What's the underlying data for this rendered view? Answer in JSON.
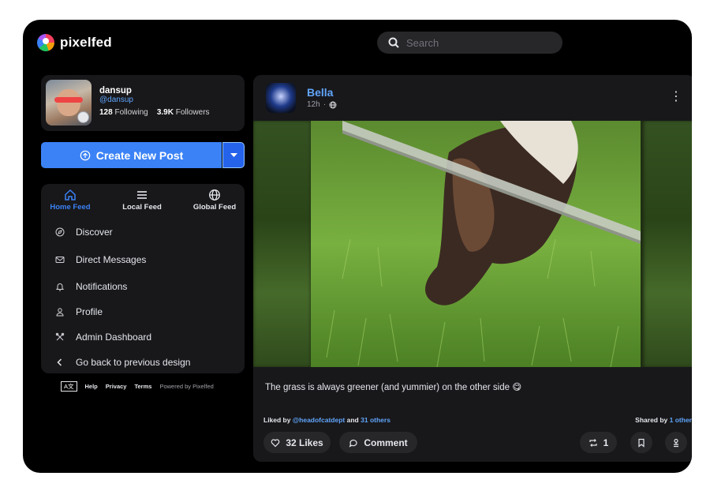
{
  "app": {
    "name": "pixelfed"
  },
  "search": {
    "placeholder": "Search"
  },
  "profile": {
    "name": "dansup",
    "handle": "@dansup",
    "following_count": "128",
    "following_label": "Following",
    "followers_count": "3.9K",
    "followers_label": "Followers"
  },
  "create_post": {
    "label": "Create New Post"
  },
  "feed_tabs": [
    {
      "label": "Home Feed",
      "icon": "home-icon",
      "active": true
    },
    {
      "label": "Local Feed",
      "icon": "menu-icon",
      "active": false
    },
    {
      "label": "Global Feed",
      "icon": "globe-icon",
      "active": false
    }
  ],
  "nav": [
    {
      "label": "Discover",
      "icon": "compass-icon"
    },
    {
      "label": "Direct Messages",
      "icon": "envelope-icon"
    },
    {
      "label": "Notifications",
      "icon": "bell-icon"
    },
    {
      "label": "Profile",
      "icon": "user-icon"
    },
    {
      "label": "Admin Dashboard",
      "icon": "tools-icon"
    },
    {
      "label": "Go back to previous design",
      "icon": "chevron-left-icon"
    }
  ],
  "footer": {
    "lang": "A文",
    "help": "Help",
    "privacy": "Privacy",
    "terms": "Terms",
    "powered": "Powered by Pixelfed"
  },
  "post": {
    "author": "Bella",
    "time": "12h",
    "visibility_icon": "globe-icon",
    "caption": "The grass is always greener (and yummier) on the other side 😋",
    "liked_prefix": "Liked by",
    "liked_user": "@headofcatdept",
    "liked_and": "and",
    "liked_others": "31 others",
    "shared_prefix": "Shared by",
    "shared_others": "1 other",
    "likes_label": "32 Likes",
    "comment_label": "Comment",
    "shares_count": "1"
  },
  "colors": {
    "accent": "#3b82f6",
    "link": "#60a5fa",
    "card": "#18181b",
    "background": "#000000"
  }
}
